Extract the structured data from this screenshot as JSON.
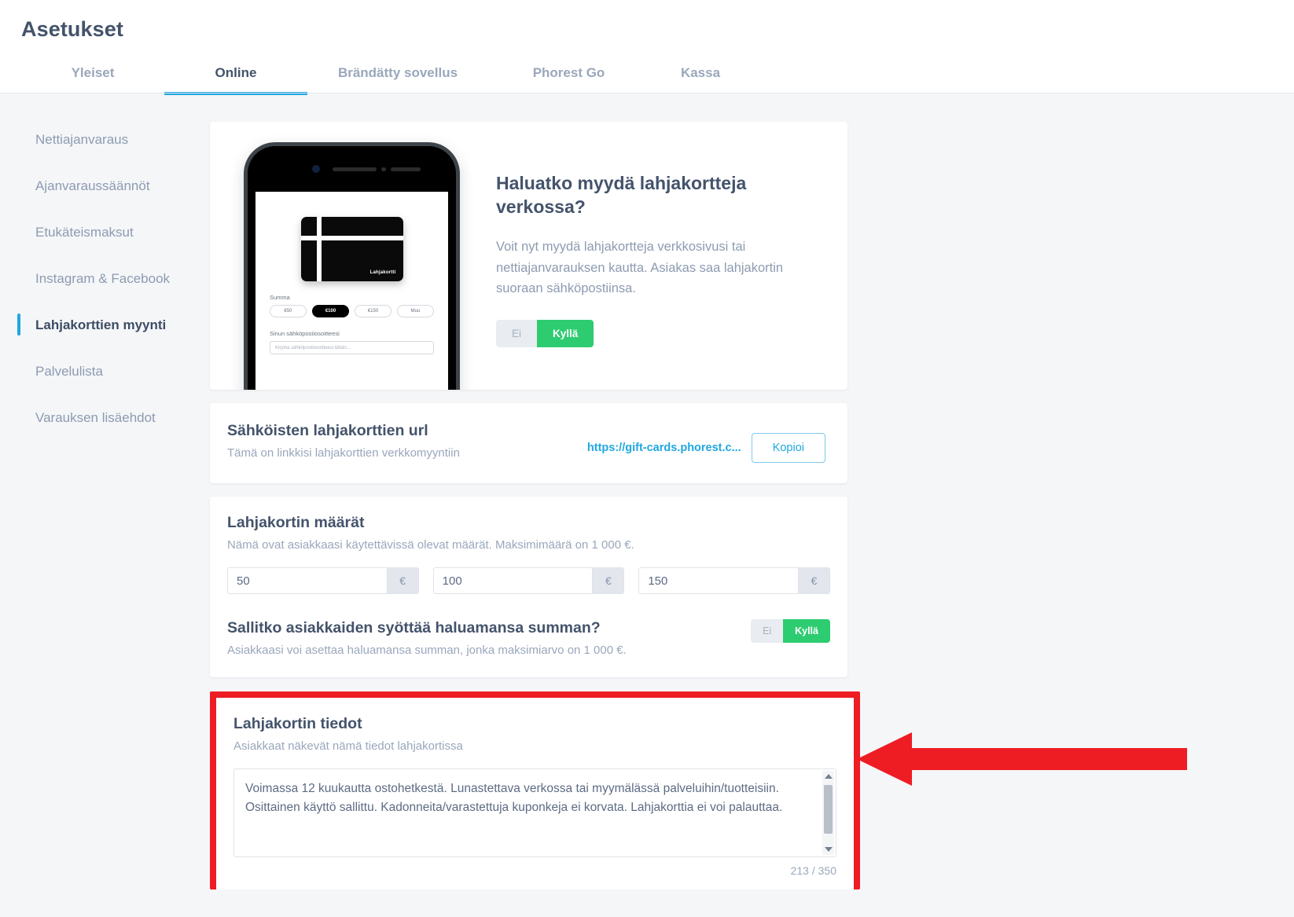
{
  "header": {
    "title": "Asetukset",
    "tabs": [
      {
        "label": "Yleiset",
        "active": false
      },
      {
        "label": "Online",
        "active": true
      },
      {
        "label": "Brändätty sovellus",
        "active": false
      },
      {
        "label": "Phorest Go",
        "active": false
      },
      {
        "label": "Kassa",
        "active": false
      }
    ]
  },
  "sidebar": {
    "items": [
      {
        "label": "Nettiajanvaraus",
        "active": false
      },
      {
        "label": "Ajanvaraussäännöt",
        "active": false
      },
      {
        "label": "Etukäteismaksut",
        "active": false
      },
      {
        "label": "Instagram & Facebook",
        "active": false
      },
      {
        "label": "Lahjakorttien myynti",
        "active": true
      },
      {
        "label": "Palvelulista",
        "active": false
      },
      {
        "label": "Varauksen lisäehdot",
        "active": false
      }
    ]
  },
  "promo": {
    "title": "Haluatko myydä lahjakortteja verkossa?",
    "description": "Voit nyt myydä lahjakortteja verkkosivusi tai nettiajanvarauksen kautta. Asiakas saa lahjakortin suoraan sähköpostiinsa.",
    "toggle": {
      "no_label": "Ei",
      "yes_label": "Kyllä",
      "selected": "Kyllä"
    },
    "phone_preview": {
      "card_label": "Lahjakortti",
      "amount_label": "Summa",
      "chips": [
        "€50",
        "€100",
        "€150",
        "Muu"
      ],
      "chip_selected": "€100",
      "email_label": "Sinun sähköpostiosoitteesi",
      "email_placeholder": "Kirjoita sähköpostiosoitteesi tähän..."
    }
  },
  "url_section": {
    "title": "Sähköisten lahjakorttien url",
    "subtitle": "Tämä on linkkisi lahjakorttien verkkomyyntiin",
    "url_display": "https://gift-cards.phorest.c...",
    "copy_label": "Kopioi"
  },
  "amounts_section": {
    "title": "Lahjakortin määrät",
    "subtitle": "Nämä ovat asiakkaasi käytettävissä olevat määrät. Maksimimäärä on 1 000 €.",
    "fields": [
      {
        "value": "50",
        "suffix": "€"
      },
      {
        "value": "100",
        "suffix": "€"
      },
      {
        "value": "150",
        "suffix": "€"
      }
    ],
    "allow_custom": {
      "title": "Sallitko asiakkaiden syöttää haluamansa summan?",
      "subtitle": "Asiakkaasi voi asettaa haluamansa summan, jonka maksimiarvo on 1 000 €.",
      "toggle": {
        "no_label": "Ei",
        "yes_label": "Kyllä",
        "selected": "Kyllä"
      }
    }
  },
  "details_section": {
    "title": "Lahjakortin tiedot",
    "subtitle": "Asiakkaat näkevät nämä tiedot lahjakortissa",
    "textarea_value": "Voimassa 12 kuukautta ostohetkestä. Lunastettava verkossa tai myymälässä palveluihin/tuotteisiin. Osittainen käyttö sallittu. Kadonneita/varastettuja kuponkeja ei korvata. Lahjakorttia ei voi palauttaa.",
    "counter": "213 / 350"
  },
  "annotation": {
    "highlight_color": "#ee1c23",
    "arrow_color": "#ee1c23"
  }
}
